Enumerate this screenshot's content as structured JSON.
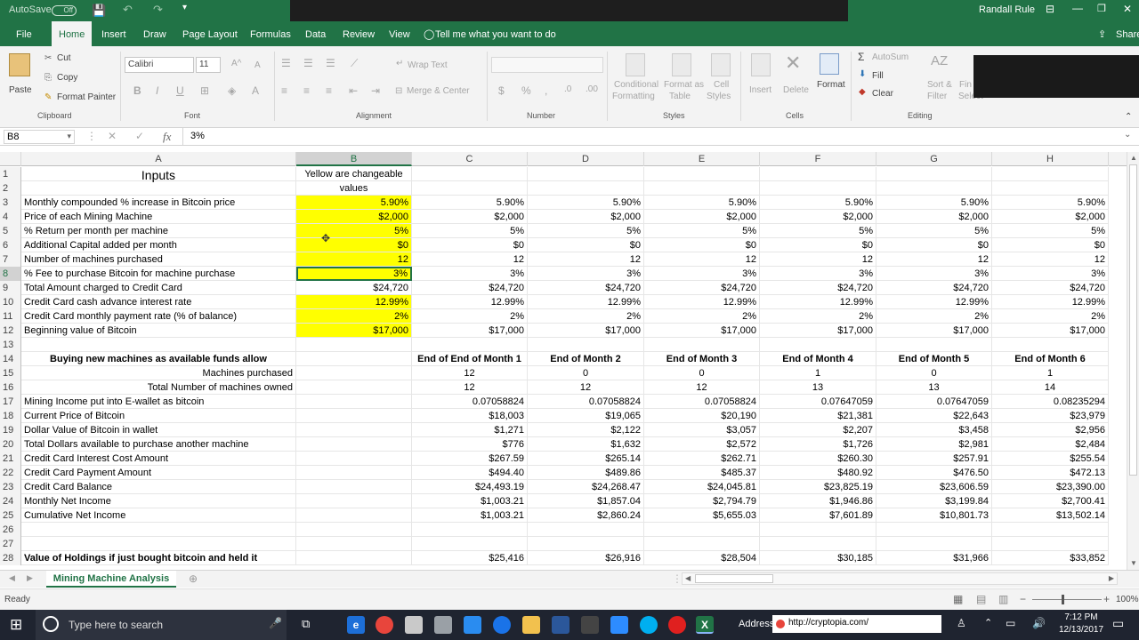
{
  "titlebar": {
    "autosave": "AutoSave",
    "autosave_state": "Off",
    "user": "Randall Rule"
  },
  "menu": [
    "File",
    "Home",
    "Insert",
    "Draw",
    "Page Layout",
    "Formulas",
    "Data",
    "Review",
    "View"
  ],
  "tell_me": "Tell me what you want to do",
  "share": "Share",
  "ribbon": {
    "clipboard": {
      "paste": "Paste",
      "cut": "Cut",
      "copy": "Copy",
      "format_painter": "Format Painter",
      "label": "Clipboard"
    },
    "font": {
      "name": "Calibri",
      "size": "11",
      "label": "Font"
    },
    "alignment": {
      "wrap": "Wrap Text",
      "merge": "Merge & Center",
      "label": "Alignment"
    },
    "number": {
      "label": "Number",
      "currency": "$",
      "percent": "%"
    },
    "styles": {
      "conditional": "Conditional",
      "conditional2": "Formatting",
      "format_as": "Format as",
      "table": "Table",
      "cell": "Cell",
      "styles_word": "Styles",
      "label": "Styles"
    },
    "cells": {
      "insert": "Insert",
      "delete": "Delete",
      "format": "Format",
      "label": "Cells"
    },
    "editing": {
      "autosum": "AutoSum",
      "fill": "Fill",
      "clear": "Clear",
      "sort": "Sort &",
      "filter": "Filter",
      "find": "Fin",
      "select": "Select",
      "label": "Editing"
    }
  },
  "formula_bar": {
    "name_box": "B8",
    "cancel": "✕",
    "confirm": "✓",
    "fx": "fx",
    "value": "3%"
  },
  "columns": [
    "A",
    "B",
    "C",
    "D",
    "E",
    "F",
    "G",
    "H"
  ],
  "rows": [
    {
      "n": "1",
      "a": "Inputs",
      "b": "Yellow are changeable",
      "vals": [
        "",
        "",
        "",
        "",
        "",
        ""
      ]
    },
    {
      "n": "2",
      "a": "",
      "b": "values",
      "vals": [
        "",
        "",
        "",
        "",
        "",
        ""
      ]
    },
    {
      "n": "3",
      "a": "Monthly compounded % increase in Bitcoin price",
      "b": "5.90%",
      "vals": [
        "5.90%",
        "5.90%",
        "5.90%",
        "5.90%",
        "5.90%",
        "5.90%"
      ]
    },
    {
      "n": "4",
      "a": "Price of each Mining Machine",
      "b": "$2,000",
      "vals": [
        "$2,000",
        "$2,000",
        "$2,000",
        "$2,000",
        "$2,000",
        "$2,000"
      ]
    },
    {
      "n": "5",
      "a": "% Return per month per machine",
      "b": "5%",
      "vals": [
        "5%",
        "5%",
        "5%",
        "5%",
        "5%",
        "5%"
      ]
    },
    {
      "n": "6",
      "a": "Additional Capital added per month",
      "b": "$0",
      "vals": [
        "$0",
        "$0",
        "$0",
        "$0",
        "$0",
        "$0"
      ]
    },
    {
      "n": "7",
      "a": "Number of machines purchased",
      "b": "12",
      "vals": [
        "12",
        "12",
        "12",
        "12",
        "12",
        "12"
      ]
    },
    {
      "n": "8",
      "a": "% Fee to purchase Bitcoin for machine purchase",
      "b": "3%",
      "vals": [
        "3%",
        "3%",
        "3%",
        "3%",
        "3%",
        "3%"
      ]
    },
    {
      "n": "9",
      "a": "Total Amount charged to Credit Card",
      "b": "$24,720",
      "vals": [
        "$24,720",
        "$24,720",
        "$24,720",
        "$24,720",
        "$24,720",
        "$24,720"
      ]
    },
    {
      "n": "10",
      "a": "Credit Card cash advance interest rate",
      "b": "12.99%",
      "vals": [
        "12.99%",
        "12.99%",
        "12.99%",
        "12.99%",
        "12.99%",
        "12.99%"
      ]
    },
    {
      "n": "11",
      "a": "Credit Card monthly payment rate (% of balance)",
      "b": "2%",
      "vals": [
        "2%",
        "2%",
        "2%",
        "2%",
        "2%",
        "2%"
      ]
    },
    {
      "n": "12",
      "a": "Beginning value of Bitcoin",
      "b": "$17,000",
      "vals": [
        "$17,000",
        "$17,000",
        "$17,000",
        "$17,000",
        "$17,000",
        "$17,000"
      ]
    },
    {
      "n": "13",
      "a": "",
      "b": "",
      "vals": [
        "",
        "",
        "",
        "",
        "",
        ""
      ]
    },
    {
      "n": "14",
      "a": "Buying new machines as available funds allow",
      "b": "",
      "vals": [
        "End of End of Month 1",
        "End of Month 2",
        "End of Month 3",
        "End of Month 4",
        "End of Month 5",
        "End of Month 6"
      ]
    },
    {
      "n": "15",
      "a": "Machines purchased",
      "b": "",
      "vals": [
        "12",
        "0",
        "0",
        "1",
        "0",
        "1"
      ]
    },
    {
      "n": "16",
      "a": "Total Number of machines owned",
      "b": "",
      "vals": [
        "12",
        "12",
        "12",
        "13",
        "13",
        "14"
      ]
    },
    {
      "n": "17",
      "a": "Mining Income put into E-wallet as bitcoin",
      "b": "",
      "vals": [
        "0.07058824",
        "0.07058824",
        "0.07058824",
        "0.07647059",
        "0.07647059",
        "0.08235294"
      ]
    },
    {
      "n": "18",
      "a": "Current Price of Bitcoin",
      "b": "",
      "vals": [
        "$18,003",
        "$19,065",
        "$20,190",
        "$21,381",
        "$22,643",
        "$23,979"
      ]
    },
    {
      "n": "19",
      "a": "Dollar Value of Bitcoin in wallet",
      "b": "",
      "vals": [
        "$1,271",
        "$2,122",
        "$3,057",
        "$2,207",
        "$3,458",
        "$2,956"
      ]
    },
    {
      "n": "20",
      "a": "Total Dollars available to purchase another machine",
      "b": "",
      "vals": [
        "$776",
        "$1,632",
        "$2,572",
        "$1,726",
        "$2,981",
        "$2,484"
      ]
    },
    {
      "n": "21",
      "a": "Credit Card Interest Cost Amount",
      "b": "",
      "vals": [
        "$267.59",
        "$265.14",
        "$262.71",
        "$260.30",
        "$257.91",
        "$255.54"
      ]
    },
    {
      "n": "22",
      "a": "Credit Card Payment Amount",
      "b": "",
      "vals": [
        "$494.40",
        "$489.86",
        "$485.37",
        "$480.92",
        "$476.50",
        "$472.13"
      ]
    },
    {
      "n": "23",
      "a": "Credit Card Balance",
      "b": "",
      "vals": [
        "$24,493.19",
        "$24,268.47",
        "$24,045.81",
        "$23,825.19",
        "$23,606.59",
        "$23,390.00"
      ]
    },
    {
      "n": "24",
      "a": "Monthly Net Income",
      "b": "",
      "vals": [
        "$1,003.21",
        "$1,857.04",
        "$2,794.79",
        "$1,946.86",
        "$3,199.84",
        "$2,700.41"
      ]
    },
    {
      "n": "25",
      "a": "Cumulative Net Income",
      "b": "",
      "vals": [
        "$1,003.21",
        "$2,860.24",
        "$5,655.03",
        "$7,601.89",
        "$10,801.73",
        "$13,502.14"
      ]
    },
    {
      "n": "26",
      "a": "",
      "b": "",
      "vals": [
        "",
        "",
        "",
        "",
        "",
        ""
      ]
    },
    {
      "n": "27",
      "a": "",
      "b": "",
      "vals": [
        "",
        "",
        "",
        "",
        "",
        ""
      ]
    },
    {
      "n": "28",
      "a": "Value of Holdings if just bought bitcoin and held it",
      "b": "",
      "vals": [
        "$25,416",
        "$26,916",
        "$28,504",
        "$30,185",
        "$31,966",
        "$33,852"
      ]
    }
  ],
  "sheet_tab": "Mining Machine Analysis",
  "status": {
    "ready": "Ready",
    "zoom": "100%"
  },
  "taskbar": {
    "search": "Type here to search",
    "address_label": "Address",
    "address": "http://cryptopia.com/",
    "time": "7:12 PM",
    "date": "12/13/2017"
  }
}
